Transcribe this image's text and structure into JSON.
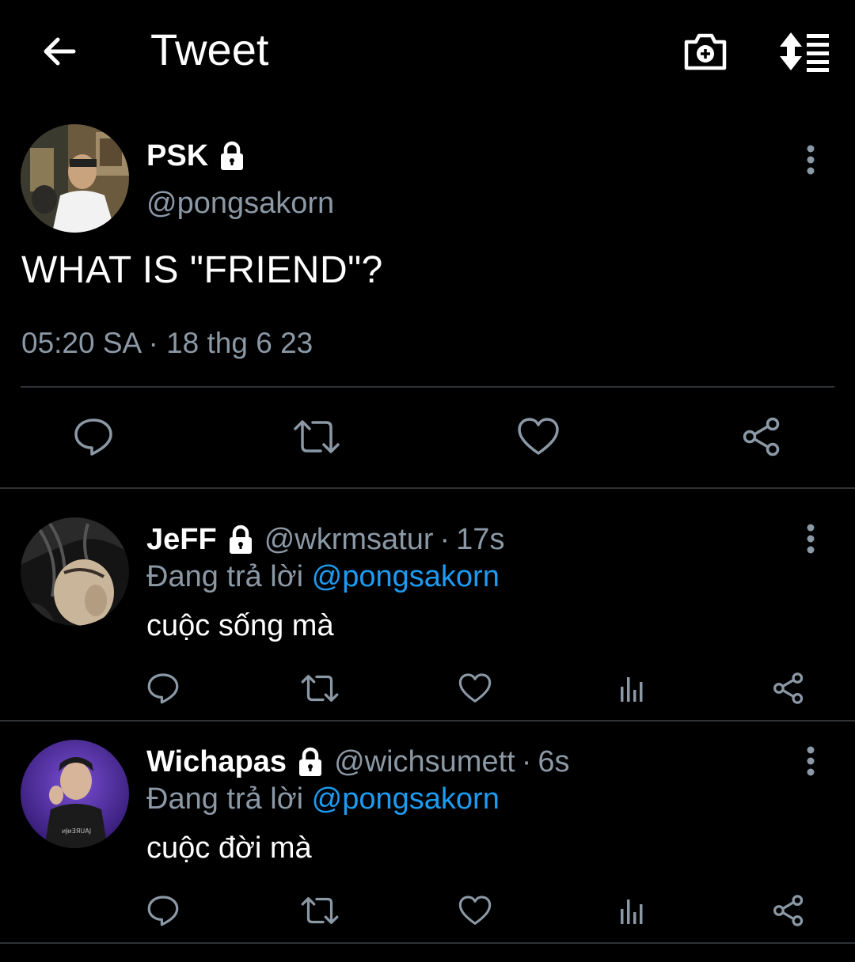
{
  "header": {
    "title": "Tweet"
  },
  "tweet": {
    "name": "PSK",
    "handle": "@pongsakorn",
    "text": "WHAT IS \"FRIEND\"?",
    "timestamp": "05:20 SA · 18 thg 6 23"
  },
  "replies": [
    {
      "name": "JeFF",
      "handle": "@wkrmsatur",
      "dot": "·",
      "time": "17s",
      "replying_prefix": "Đang trả lời ",
      "replying_to": "@pongsakorn",
      "text": "cuộc sống mà"
    },
    {
      "name": "Wichapas",
      "handle": "@wichsumett",
      "dot": "·",
      "time": "6s",
      "replying_prefix": "Đang trả lời ",
      "replying_to": "@pongsakorn",
      "text": "cuộc đời mà"
    }
  ],
  "colors": {
    "background": "#000000",
    "text": "#ffffff",
    "secondary_text": "#8b98a5",
    "link": "#1d9bf0",
    "divider": "#2f3336"
  }
}
